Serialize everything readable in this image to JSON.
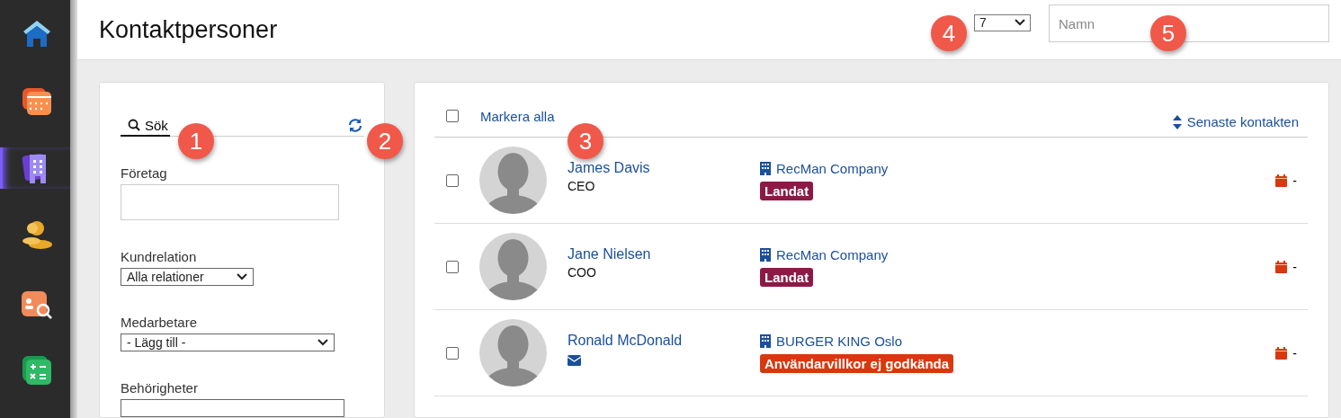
{
  "sidebar": {
    "items": [
      {
        "kind": "home",
        "selected": false
      },
      {
        "kind": "calendar",
        "selected": false
      },
      {
        "kind": "building",
        "selected": true
      },
      {
        "kind": "people",
        "selected": false
      },
      {
        "kind": "person-search",
        "selected": false
      },
      {
        "kind": "calculator",
        "selected": false
      }
    ]
  },
  "header": {
    "title": "Kontaktpersoner",
    "page_size": "7",
    "name_search": {
      "placeholder": "Namn"
    }
  },
  "filter_panel": {
    "tab": {
      "label": "Sök",
      "selected": true
    },
    "filters": [
      {
        "kind": "input",
        "label": "Företag"
      },
      {
        "kind": "select",
        "label": "Kundrelation",
        "value": "Alla relationer"
      },
      {
        "kind": "select",
        "label": "Medarbetare",
        "value": "- Lägg till -"
      },
      {
        "kind": "select",
        "label": "Behörigheter"
      }
    ]
  },
  "contacts": {
    "select_all": {
      "label": "Markera alla",
      "checked": false
    },
    "sort": "Senaste kontakten",
    "rows": [
      {
        "checked": false,
        "name": "James Davis",
        "kind": "title",
        "title": "CEO",
        "company": "RecMan Company",
        "tag": "Landat",
        "color": "#8c1a45",
        "last_contact": "-"
      },
      {
        "checked": false,
        "name": "Jane Nielsen",
        "kind": "title",
        "title": "COO",
        "company": "RecMan Company",
        "tag": "Landat",
        "color": "#8c1a45",
        "last_contact": "-"
      },
      {
        "checked": false,
        "name": "Ronald McDonald",
        "kind": "email",
        "company": "BURGER KING Oslo",
        "tag": "Användarvillkor ej godkända",
        "color": "#d9380e",
        "last_contact": "-"
      }
    ]
  },
  "callouts": [
    "1",
    "2",
    "3",
    "4",
    "5"
  ]
}
